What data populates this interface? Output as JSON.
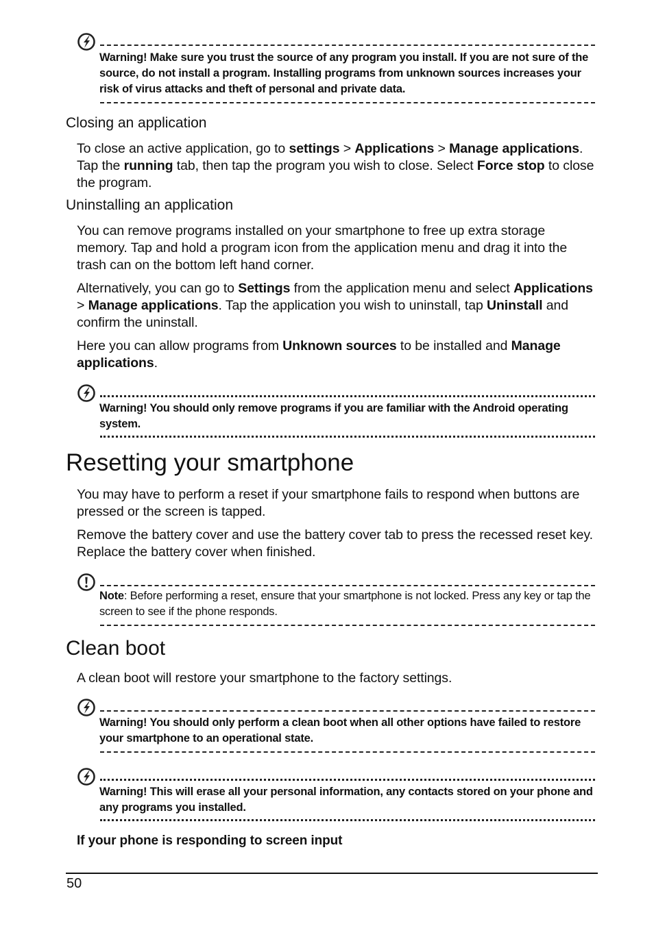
{
  "callouts": {
    "warn_trust": {
      "icon": "warning-lightning-icon",
      "text": "Warning! Make sure you trust the source of any program you install. If you are not sure of the source, do not install a program. Installing programs from unknown sources increases your risk of virus attacks and theft of personal and private data."
    },
    "warn_remove": {
      "icon": "warning-lightning-icon",
      "text": "Warning! You should only remove programs if you are familiar with the Android operating system."
    },
    "note_reset": {
      "icon": "exclamation-icon",
      "label": "Note",
      "text": ": Before performing a reset, ensure that your smartphone is not locked. Press any key or tap the screen to see if the phone responds."
    },
    "warn_clean_boot": {
      "icon": "warning-lightning-icon",
      "text": "Warning! You should only perform a clean boot when all other options have failed to restore your smartphone to an operational state."
    },
    "warn_erase": {
      "icon": "warning-lightning-icon",
      "text": "Warning! This will erase all your personal information, any contacts stored on your phone and any programs you installed."
    }
  },
  "closing": {
    "heading": "Closing an application",
    "p1": [
      {
        "t": "To close an active application, go to ",
        "b": false
      },
      {
        "t": "settings",
        "b": true
      },
      {
        "t": " > ",
        "b": false
      },
      {
        "t": "Applications",
        "b": true
      },
      {
        "t": " > ",
        "b": false
      },
      {
        "t": "Manage applications",
        "b": true
      },
      {
        "t": ". Tap the ",
        "b": false
      },
      {
        "t": "running",
        "b": true
      },
      {
        "t": " tab, then tap the program you wish to close. Select ",
        "b": false
      },
      {
        "t": "Force stop",
        "b": true
      },
      {
        "t": " to close the program.",
        "b": false
      }
    ]
  },
  "uninstalling": {
    "heading": "Uninstalling an application",
    "p1": "You can remove programs installed on your smartphone to free up extra storage memory. Tap and hold a program icon from the application menu and drag it into the trash can on the bottom left hand corner.",
    "p2": [
      {
        "t": "Alternatively, you can go to ",
        "b": false
      },
      {
        "t": "Settings",
        "b": true
      },
      {
        "t": " from the application menu and select ",
        "b": false
      },
      {
        "t": "Applications",
        "b": true
      },
      {
        "t": " > ",
        "b": false
      },
      {
        "t": "Manage applications",
        "b": true
      },
      {
        "t": ". Tap the application you wish to uninstall, tap ",
        "b": false
      },
      {
        "t": "Uninstall",
        "b": true
      },
      {
        "t": " and confirm the uninstall.",
        "b": false
      }
    ],
    "p3": [
      {
        "t": "Here you can allow programs from ",
        "b": false
      },
      {
        "t": "Unknown sources",
        "b": true
      },
      {
        "t": " to be installed and ",
        "b": false
      },
      {
        "t": "Manage applications",
        "b": true
      },
      {
        "t": ".",
        "b": false
      }
    ]
  },
  "resetting": {
    "heading": "Resetting your smartphone",
    "p1": "You may have to perform a reset if your smartphone fails to respond when buttons are pressed or the screen is tapped.",
    "p2": "Remove the battery cover and use the battery cover tab to press the recessed reset key. Replace the battery cover when finished."
  },
  "clean_boot": {
    "heading": "Clean boot",
    "p1": "A clean boot will restore your smartphone to the factory settings.",
    "subheading": "If your phone is responding to screen input"
  },
  "footer": {
    "page_number": "50"
  }
}
